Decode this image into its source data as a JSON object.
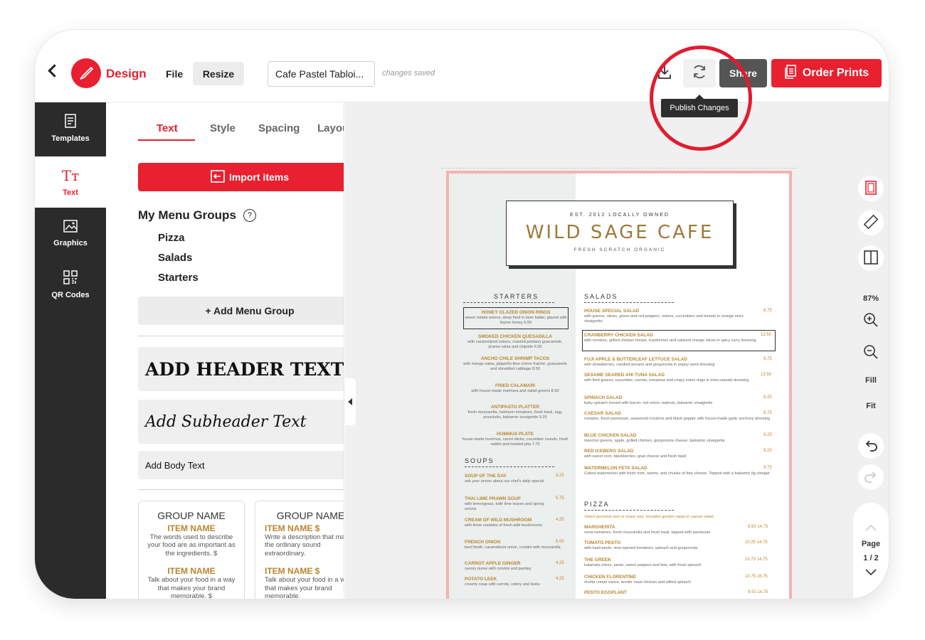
{
  "header": {
    "brand": "Design",
    "file": "File",
    "resize": "Resize",
    "document_name": "Cafe Pastel Tabloi...",
    "status": "changes saved",
    "share": "Share",
    "order_prints": "Order Prints",
    "tooltip": "Publish Changes"
  },
  "rail": {
    "templates": "Templates",
    "text": "Text",
    "graphics": "Graphics",
    "qr": "QR Codes"
  },
  "panel": {
    "tabs": [
      "Text",
      "Style",
      "Spacing",
      "Layout"
    ],
    "import": "Import items",
    "groups_title": "My Menu Groups",
    "help": "?",
    "groups": [
      "Pizza",
      "Salads",
      "Starters"
    ],
    "add_group": "+ Add Menu Group",
    "header_text": "ADD HEADER TEXT",
    "subheader_text": "Add Subheader Text",
    "body_text": "Add Body Text",
    "tmpl1": {
      "group": "GROUP NAME",
      "item1": "ITEM NAME",
      "desc1": "The words used to describe your food are as important as the ingredients. $",
      "item2": "ITEM NAME",
      "desc2": "Talk about your food in a way that makes your brand memorable. $"
    },
    "tmpl2": {
      "group": "GROUP NAME",
      "item1": "ITEM NAME $",
      "desc1": "Write a description that makes the ordinary sound extraordinary.",
      "item2": "ITEM NAME $",
      "desc2": "Talk about your food in a way that makes your brand memorable."
    }
  },
  "menu": {
    "est": "EST. 2012 LOCALLY OWNED",
    "name": "WILD SAGE CAFE",
    "tagline": "FRESH SCRATCH ORGANIC",
    "starters_h": "STARTERS",
    "soups_h": "SOUPS",
    "salads_h": "SALADS",
    "pizza_h": "PIZZA",
    "pizza_note": "Select personal size or share size. Includes garden salad or caesar salad.",
    "starters": [
      {
        "name": "HONEY GLAZED ONION RINGS",
        "desc": "sweet vidalia onions, deep fried in beer batter, glazed with thyme honey 6.50"
      },
      {
        "name": "SMOKED CHICKEN QUESADILLA",
        "desc": "with caramelized onions, roasted poblano guacamole, jicama salsa and chipotle 6.50"
      },
      {
        "name": "ANCHO CHILE SHRIMP TACOS",
        "desc": "with mango salsa, jalapeño-lime crème fraiche, guacamole and shredded cabbage 8.50"
      },
      {
        "name": "FRIED CALAMARI",
        "desc": "with house-made marinara and salad greens 8.50"
      },
      {
        "name": "ANTIPASTO PLATTER",
        "desc": "fresh mozzarella, heirloom tomatoes, fresh basil, egg, prosciutto, balsamic vinaigrette 9.25"
      },
      {
        "name": "HUMMUS PLATE",
        "desc": "house-made hummus, carrot sticks, cucumber rounds, fresh radish and toasted pita 7.75"
      }
    ],
    "soups": [
      {
        "name": "SOUP OF THE DAY",
        "price": "3.25",
        "desc": "ask your server about our chef's daily special"
      },
      {
        "name": "THAI LIME PRAWN SOUP",
        "price": "5.75",
        "desc": "with lemongrass, kafir lime leaves and spring onions"
      },
      {
        "name": "CREAM OF WILD MUSHROOM",
        "price": "4.25",
        "desc": "with three varieties of fresh wild mushrooms"
      },
      {
        "name": "FRENCH ONION",
        "price": "5.00",
        "desc": "beef broth, caramelized onion, crostini with mozzarella"
      },
      {
        "name": "CARROT APPLE GINGER",
        "price": "4.25",
        "desc": "savory puree with crostini and parsley"
      },
      {
        "name": "POTATO LEEK",
        "price": "4.25",
        "desc": "creamy soup with carrots, celery and leeks"
      }
    ],
    "salads": [
      {
        "name": "HOUSE SPECIAL SALAD",
        "price": "6.75",
        "desc": "with greens, olives, green and red peppers, onions, cucumbers and tomato in orange miso vinaigrette"
      },
      {
        "name": "CRANBERRY CHICKEN SALAD",
        "price": "12.50",
        "desc": "with romaine, grilled chicken breast, cranberries and satsumi orange slices in spicy curry dressing"
      },
      {
        "name": "FUJI APPLE & BUTTERLEAF LETTUCE SALAD",
        "price": "9.75",
        "desc": "with strawberries, candied pecans and gorgonzola in poppy seed dressing"
      },
      {
        "name": "SESAME SEARED AHI TUNA SALAD",
        "price": "13.50",
        "desc": "with field greens, cucumber, carrots, tomatoes and crispy onion rings in miso-wasabi dressing"
      },
      {
        "name": "SPINACH SALAD",
        "price": "8.25",
        "desc": "baby spinach tossed with bacon, red onion, walnuts, balsamic vinaigrette"
      },
      {
        "name": "CAESAR SALAD",
        "price": "8.75",
        "desc": "romaine, fresh parmesan, seasoned croutons and black pepper with house-made garlic anchovy dressing"
      },
      {
        "name": "BLUE CHICKEN SALAD",
        "price": "9.25",
        "desc": "mesclun greens, apple, grilled chicken, gorgonzola cheese, balsamic vinaigrette"
      },
      {
        "name": "RED ICEBERG SALAD",
        "price": "9.25",
        "desc": "with sweet corn, blackberries, goat cheese and fresh basil"
      },
      {
        "name": "WATERMELON FETA SALAD",
        "price": "9.75",
        "desc": "Cubed watermelon with fresh mint, raisins, and chunks of feta cheese. Topped with a balsamic fig vinegar"
      }
    ],
    "pizza": [
      {
        "name": "MARGHERITA",
        "price": "9.50 14.75",
        "desc": "roma tomatoes, fresh mozzarella and fresh basil, topped with parmesan"
      },
      {
        "name": "TOMATO PESTO",
        "price": "10.25 14.75",
        "desc": "with basil pesto, vine-ripened tomatoes, spinach and gorgonzola"
      },
      {
        "name": "THE GREEK",
        "price": "10.75 14.75",
        "desc": "kalamata olives, pesto, sweet peppers and feta, with fresh spinach"
      },
      {
        "name": "CHICKEN FLORENTINE",
        "price": "10.75 16.75",
        "desc": "ricotta cream sauce, tender roast chicken and wilted spinach"
      },
      {
        "name": "PESTO EGGPLANT",
        "price": "9.50 14.75",
        "desc": ""
      }
    ]
  },
  "right_tools": {
    "zoom": "87%",
    "fill": "Fill",
    "fit": "Fit",
    "page_label": "Page",
    "page_num": "1 / 2"
  }
}
